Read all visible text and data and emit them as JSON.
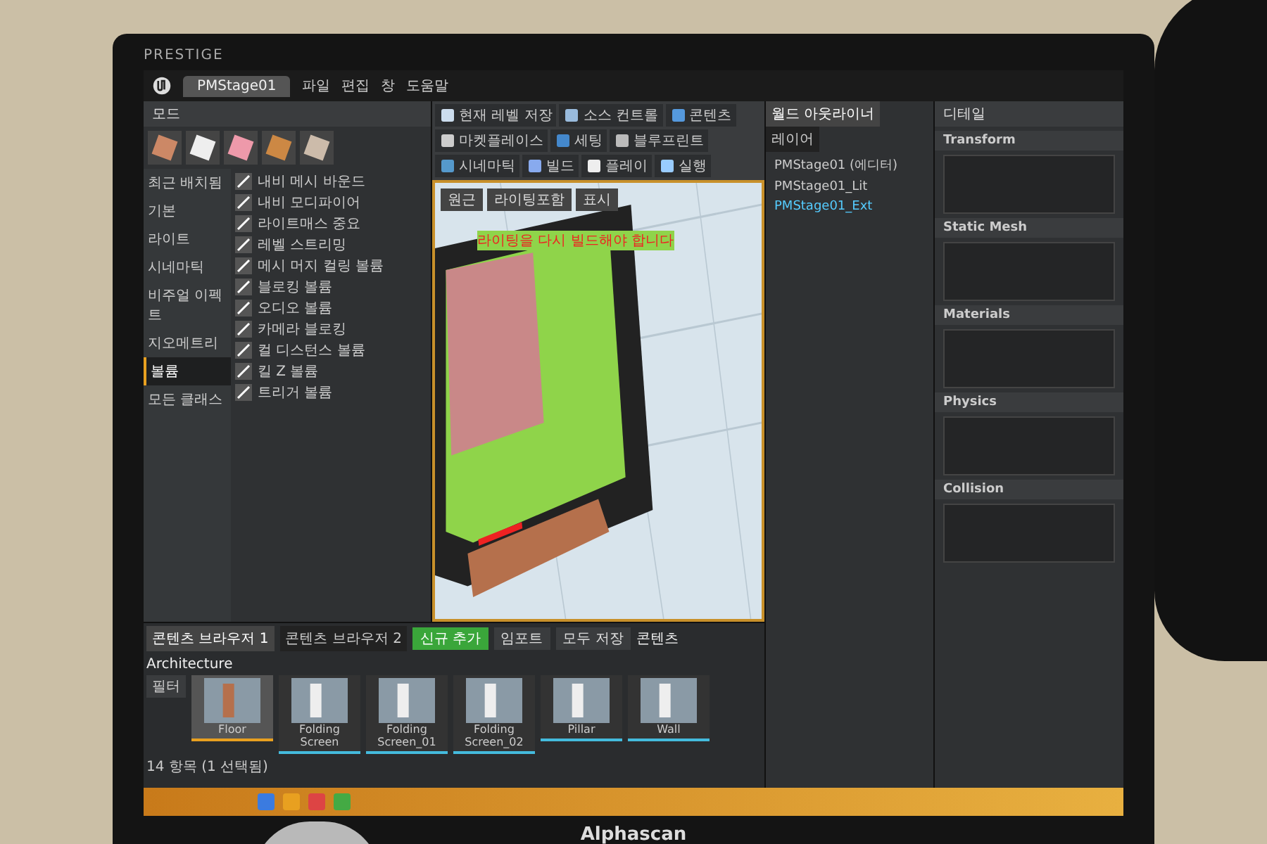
{
  "monitor": {
    "brand": "PRESTIGE",
    "model": "Alphascan"
  },
  "editor": {
    "tab": "PMStage01",
    "menu": [
      "파일",
      "편집",
      "창",
      "도움말"
    ],
    "modes": {
      "title": "모드",
      "categories": [
        {
          "label": "최근 배치됨",
          "selected": false
        },
        {
          "label": "기본",
          "selected": false
        },
        {
          "label": "라이트",
          "selected": false
        },
        {
          "label": "시네마틱",
          "selected": false
        },
        {
          "label": "비주얼 이펙트",
          "selected": false
        },
        {
          "label": "지오메트리",
          "selected": false
        },
        {
          "label": "볼륨",
          "selected": true
        },
        {
          "label": "모든 클래스",
          "selected": false
        }
      ],
      "items": [
        "내비 메시 바운드",
        "내비 모디파이어",
        "라이트매스 중요",
        "레벨 스트리밍",
        "메시 머지 컬링 볼륨",
        "블로킹 볼륨",
        "오디오 볼륨",
        "카메라 블로킹",
        "컬 디스턴스 볼륨",
        "킬 Z 볼륨",
        "트리거 볼륨"
      ]
    },
    "toolbar": [
      "현재 레벨 저장",
      "소스 컨트롤",
      "콘텐츠",
      "마켓플레이스",
      "세팅",
      "블루프린트",
      "시네마틱",
      "빌드",
      "플레이",
      "실행"
    ],
    "viewport": {
      "buttons": [
        "원근",
        "라이팅포함",
        "표시"
      ],
      "warning": "라이팅을 다시 빌드해야 합니다"
    },
    "outliner": {
      "tabs": [
        {
          "label": "월드 아웃라이너",
          "selected": true
        },
        {
          "label": "레이어",
          "selected": false
        }
      ],
      "items": [
        {
          "label": "PMStage01 (에디터)",
          "selected": false
        },
        {
          "label": "PMStage01_Lit",
          "selected": false
        },
        {
          "label": "PMStage01_Ext",
          "selected": true
        }
      ]
    },
    "details": {
      "title": "디테일",
      "sections": [
        "Transform",
        "Static Mesh",
        "Materials",
        "Physics",
        "Collision"
      ]
    },
    "content_browser": {
      "tabs": [
        {
          "label": "콘텐츠 브라우저 1",
          "selected": true
        },
        {
          "label": "콘텐츠 브라우저 2",
          "selected": false
        }
      ],
      "add": "신규 추가",
      "import": "임포트",
      "save": "모두 저장",
      "filter": "필터",
      "path": [
        "콘텐츠",
        "Architecture"
      ],
      "assets": [
        {
          "label": "Floor",
          "selected": true
        },
        {
          "label": "Folding Screen",
          "selected": false
        },
        {
          "label": "Folding Screen_01",
          "selected": false
        },
        {
          "label": "Folding Screen_02",
          "selected": false
        },
        {
          "label": "Pillar",
          "selected": false
        },
        {
          "label": "Wall",
          "selected": false
        }
      ],
      "count": "14 항목 (1 선택됨)"
    }
  }
}
